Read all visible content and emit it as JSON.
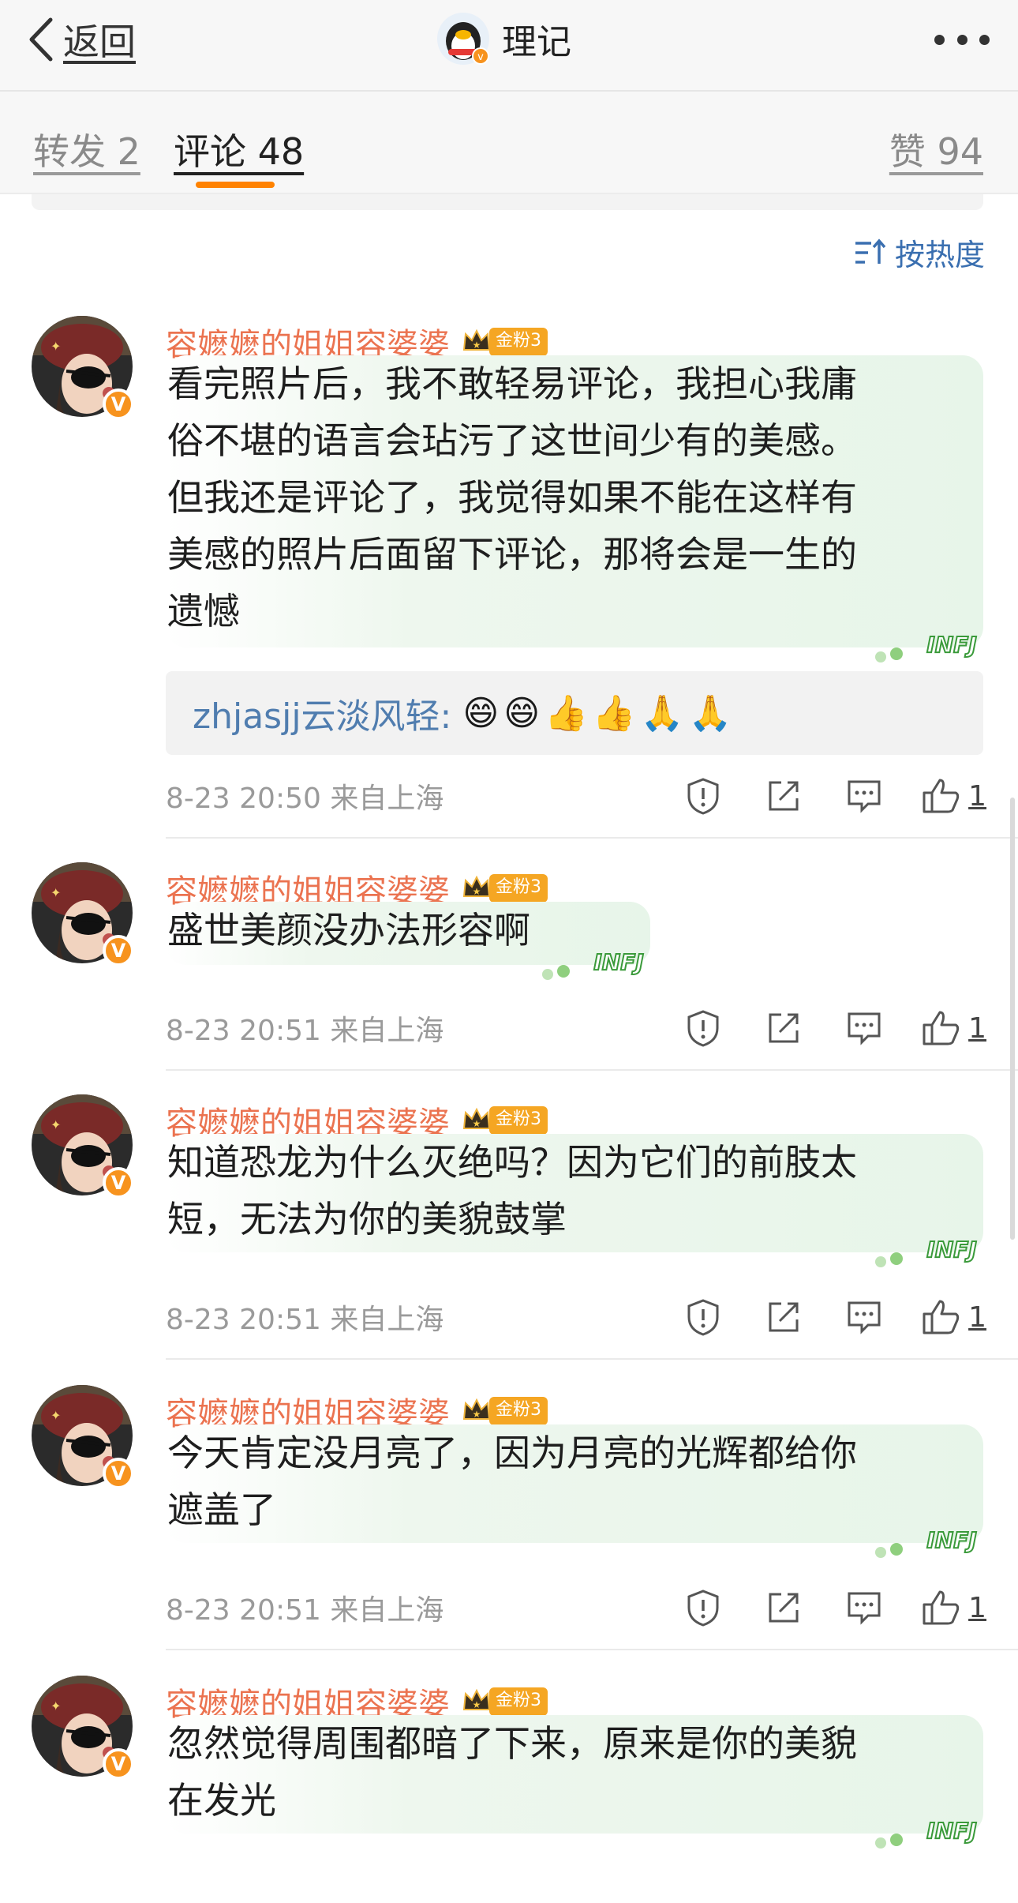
{
  "nav": {
    "back_label": "返回",
    "title": "理记"
  },
  "tabs": {
    "repost": "转发 2",
    "comments": "评论 48",
    "likes": "赞 94"
  },
  "sort_label": "按热度",
  "colors": {
    "accent": "#ff8200",
    "username": "#eb7350",
    "link": "#507daf"
  },
  "comments": [
    {
      "user": "容嬷嬷的姐姐容婆婆",
      "fan_level": "金粉3",
      "text": "看完照片后，我不敢轻易评论，我担心我庸\n俗不堪的语言会玷污了这世间少有的美感。\n但我还是评论了，我觉得如果不能在这样有\n美感的照片后面留下评论，那将会是一生的\n遗憾",
      "reply_user": "zhjasjj云淡风轻:",
      "reply_emojis": "😄😄👍👍🙏🙏",
      "time": "8-23 20:50  来自上海",
      "likes": "1"
    },
    {
      "user": "容嬷嬷的姐姐容婆婆",
      "fan_level": "金粉3",
      "text": "盛世美颜没办法形容啊",
      "time": "8-23 20:51  来自上海",
      "likes": "1"
    },
    {
      "user": "容嬷嬷的姐姐容婆婆",
      "fan_level": "金粉3",
      "text": "知道恐龙为什么灭绝吗？因为它们的前肢太\n短，无法为你的美貌鼓掌",
      "time": "8-23 20:51  来自上海",
      "likes": "1"
    },
    {
      "user": "容嬷嬷的姐姐容婆婆",
      "fan_level": "金粉3",
      "text": "今天肯定没月亮了，因为月亮的光辉都给你\n遮盖了",
      "time": "8-23 20:51  来自上海",
      "likes": "1"
    },
    {
      "user": "容嬷嬷的姐姐容婆婆",
      "fan_level": "金粉3",
      "text": "忽然觉得周围都暗了下来，原来是你的美貌\n在发光"
    }
  ],
  "bubble_mark": "INFJ"
}
